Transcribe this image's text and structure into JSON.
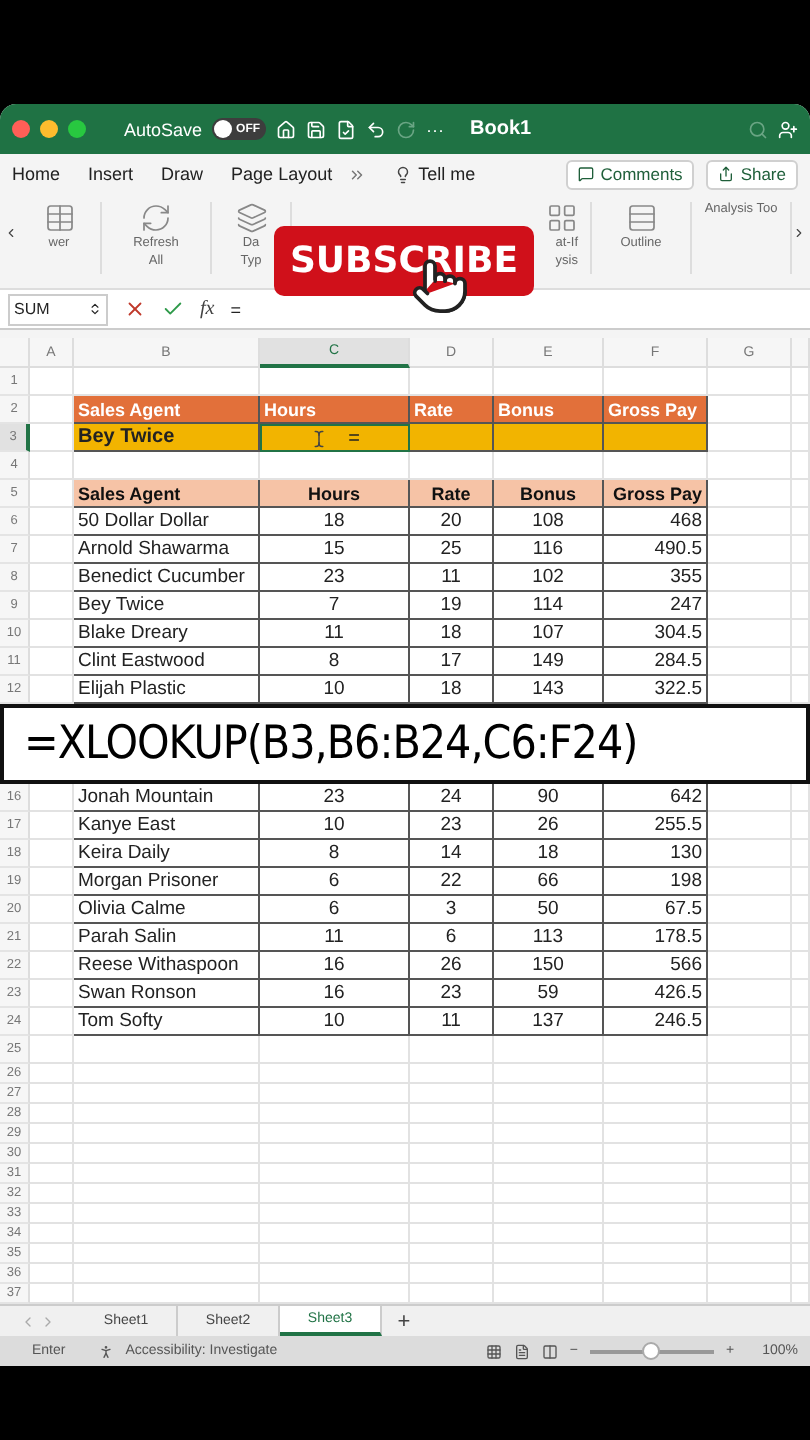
{
  "title_bar": {
    "autosave_label": "AutoSave",
    "autosave": {
      "on": false,
      "label": "OFF"
    },
    "more": "···",
    "title": "Book1"
  },
  "ribbon_tabs": [
    {
      "label": "Home"
    },
    {
      "label": "Insert"
    },
    {
      "label": "Draw"
    },
    {
      "label": "Page Layout"
    }
  ],
  "tell_me": "Tell me",
  "comments": "Comments",
  "share": "Share",
  "ribbon_items": [
    {
      "kind": "text",
      "lines": [
        "wer"
      ]
    },
    {
      "kind": "refresh",
      "lines": [
        "Refresh",
        "All"
      ]
    },
    {
      "kind": "data",
      "lines": [
        "Da",
        "Typ"
      ]
    },
    {
      "kind": "whatif",
      "lines": [
        "at-If",
        "ysis"
      ]
    },
    {
      "kind": "outline",
      "lines": [
        "Outline"
      ]
    },
    {
      "kind": "analysis",
      "lines": [
        "Analysis Too"
      ]
    }
  ],
  "overlay_button": "SUBSCRIBE",
  "formula_bar": {
    "name_box": "SUM",
    "fx": "fx",
    "value": "="
  },
  "columns": [
    {
      "label": "A",
      "selected": false
    },
    {
      "label": "B",
      "selected": false
    },
    {
      "label": "C",
      "selected": true
    },
    {
      "label": "D",
      "selected": false
    },
    {
      "label": "E",
      "selected": false
    },
    {
      "label": "F",
      "selected": false
    },
    {
      "label": "G",
      "selected": false
    }
  ],
  "rows": [
    {
      "number": "1",
      "kind": "blank",
      "selected": false
    },
    {
      "number": "2",
      "kind": "title_header",
      "selected": false,
      "cells": [
        "Sales Agent",
        "Hours",
        "Rate",
        "Bonus",
        "Gross Pay"
      ]
    },
    {
      "number": "3",
      "kind": "lookup",
      "selected": true,
      "name": "Bey Twice",
      "input": "="
    },
    {
      "number": "4",
      "kind": "blank",
      "selected": false
    },
    {
      "number": "5",
      "kind": "table_header",
      "selected": false,
      "cells": [
        "Sales Agent",
        "Hours",
        "Rate",
        "Bonus",
        "Gross Pay"
      ]
    },
    {
      "number": "6",
      "kind": "data",
      "selected": false,
      "cells": [
        "50 Dollar Dollar",
        "18",
        "20",
        "108",
        "468"
      ]
    },
    {
      "number": "7",
      "kind": "data",
      "selected": false,
      "cells": [
        "Arnold Shawarma",
        "15",
        "25",
        "116",
        "490.5"
      ]
    },
    {
      "number": "8",
      "kind": "data",
      "selected": false,
      "cells": [
        "Benedict Cucumber",
        "23",
        "11",
        "102",
        "355"
      ]
    },
    {
      "number": "9",
      "kind": "data",
      "selected": false,
      "cells": [
        "Bey Twice",
        "7",
        "19",
        "114",
        "247"
      ]
    },
    {
      "number": "10",
      "kind": "data",
      "selected": false,
      "cells": [
        "Blake Dreary",
        "11",
        "18",
        "107",
        "304.5"
      ]
    },
    {
      "number": "11",
      "kind": "data",
      "selected": false,
      "cells": [
        "Clint Eastwood",
        "8",
        "17",
        "149",
        "284.5"
      ]
    },
    {
      "number": "12",
      "kind": "data",
      "selected": false,
      "cells": [
        "Elijah Plastic",
        "10",
        "18",
        "143",
        "322.5"
      ]
    },
    {
      "kind": "formula_overlay",
      "text": "=XLOOKUP(B3,B6:B24,C6:F24)"
    },
    {
      "number": "16",
      "kind": "data",
      "selected": false,
      "cells": [
        "Jonah Mountain",
        "23",
        "24",
        "90",
        "642"
      ]
    },
    {
      "number": "17",
      "kind": "data",
      "selected": false,
      "cells": [
        "Kanye East",
        "10",
        "23",
        "26",
        "255.5"
      ]
    },
    {
      "number": "18",
      "kind": "data",
      "selected": false,
      "cells": [
        "Keira Daily",
        "8",
        "14",
        "18",
        "130"
      ]
    },
    {
      "number": "19",
      "kind": "data",
      "selected": false,
      "cells": [
        "Morgan Prisoner",
        "6",
        "22",
        "66",
        "198"
      ]
    },
    {
      "number": "20",
      "kind": "data",
      "selected": false,
      "cells": [
        "Olivia Calme",
        "6",
        "3",
        "50",
        "67.5"
      ]
    },
    {
      "number": "21",
      "kind": "data",
      "selected": false,
      "cells": [
        "Parah Salin",
        "11",
        "6",
        "113",
        "178.5"
      ]
    },
    {
      "number": "22",
      "kind": "data",
      "selected": false,
      "cells": [
        "Reese Withaspoon",
        "16",
        "26",
        "150",
        "566"
      ]
    },
    {
      "number": "23",
      "kind": "data",
      "selected": false,
      "cells": [
        "Swan Ronson",
        "16",
        "23",
        "59",
        "426.5"
      ]
    },
    {
      "number": "24",
      "kind": "data",
      "selected": false,
      "cells": [
        "Tom Softy",
        "10",
        "11",
        "137",
        "246.5"
      ]
    },
    {
      "number": "25",
      "kind": "blank",
      "selected": false
    },
    {
      "number": "26",
      "kind": "blank_short",
      "selected": false
    },
    {
      "number": "27",
      "kind": "blank_short",
      "selected": false
    },
    {
      "number": "28",
      "kind": "blank_short",
      "selected": false
    },
    {
      "number": "29",
      "kind": "blank_short",
      "selected": false
    },
    {
      "number": "30",
      "kind": "blank_short",
      "selected": false
    },
    {
      "number": "31",
      "kind": "blank_short",
      "selected": false
    },
    {
      "number": "32",
      "kind": "blank_short",
      "selected": false
    },
    {
      "number": "33",
      "kind": "blank_short",
      "selected": false
    },
    {
      "number": "34",
      "kind": "blank_short",
      "selected": false
    },
    {
      "number": "35",
      "kind": "blank_short",
      "selected": false
    },
    {
      "number": "36",
      "kind": "blank_short",
      "selected": false
    },
    {
      "number": "37",
      "kind": "blank_short",
      "selected": false
    }
  ],
  "sheets": [
    {
      "label": "Sheet1",
      "selected": false
    },
    {
      "label": "Sheet2",
      "selected": false
    },
    {
      "label": "Sheet3",
      "selected": true
    }
  ],
  "add_sheet": "+",
  "status_bar": {
    "mode": "Enter",
    "accessibility": "Accessibility: Investigate",
    "zoom_out": "−",
    "zoom_slider": {
      "level": 0.5
    },
    "zoom_in": "+",
    "zoom": "100%"
  }
}
